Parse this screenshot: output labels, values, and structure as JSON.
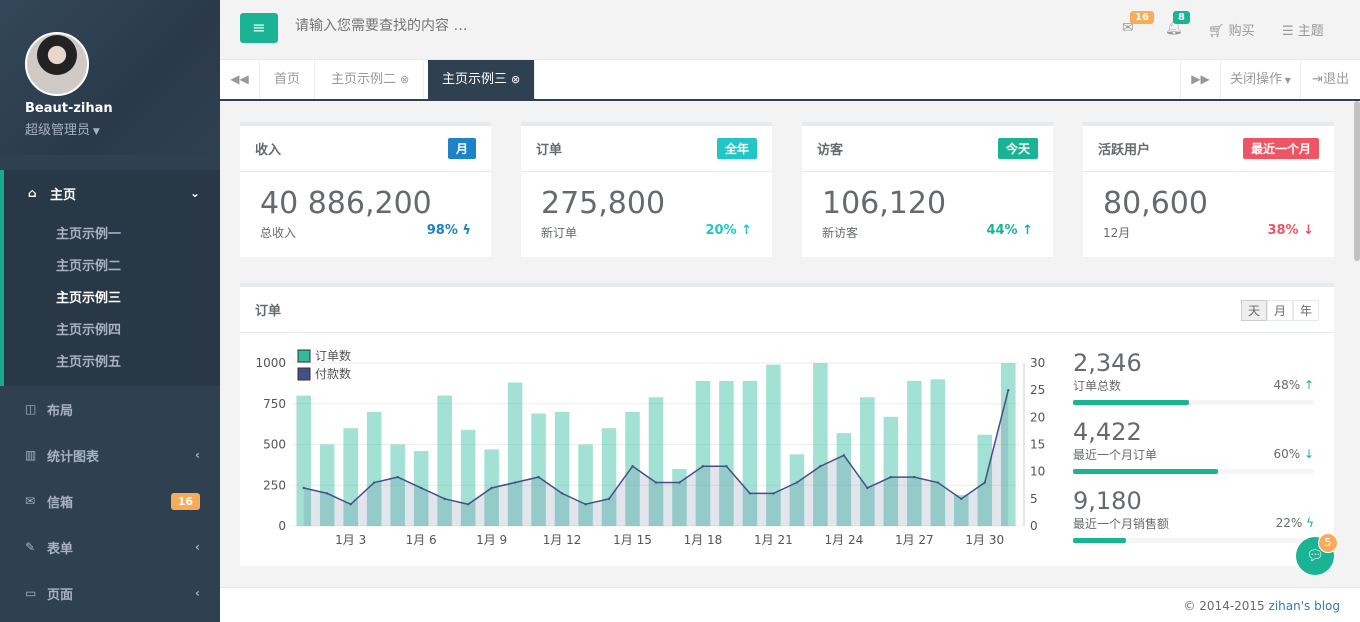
{
  "user": {
    "name": "Beaut-zihan",
    "role": "超级管理员"
  },
  "nav": {
    "home": {
      "label": "主页",
      "subs": [
        "主页示例一",
        "主页示例二",
        "主页示例三",
        "主页示例四",
        "主页示例五"
      ],
      "active_sub": 2
    },
    "items": [
      {
        "label": "布局",
        "icon": "columns-icon"
      },
      {
        "label": "统计图表",
        "icon": "bar-chart-icon"
      },
      {
        "label": "信箱",
        "icon": "envelope-icon",
        "badge": "16"
      },
      {
        "label": "表单",
        "icon": "edit-icon"
      },
      {
        "label": "页面",
        "icon": "desktop-icon"
      }
    ]
  },
  "topbar": {
    "search_placeholder": "请输入您需要查找的内容 …",
    "mail_count": "16",
    "alert_count": "8",
    "buy": "购买",
    "theme": "主题"
  },
  "tabs": {
    "items": [
      "首页",
      "主页示例二",
      "主页示例三"
    ],
    "active": 2,
    "close_ops": "关闭操作",
    "logout": "退出"
  },
  "stats": [
    {
      "title": "收入",
      "label": "月",
      "label_color": "#1c84c6",
      "value": "40 886,200",
      "sub": "总收入",
      "pct": "98%",
      "pct_icon": "bolt-icon",
      "pct_color": "#1c84c6"
    },
    {
      "title": "订单",
      "label": "全年",
      "label_color": "#23c6c8",
      "value": "275,800",
      "sub": "新订单",
      "pct": "20%",
      "pct_icon": "arrow-up-icon",
      "pct_color": "#23c6c8"
    },
    {
      "title": "访客",
      "label": "今天",
      "label_color": "#1ab394",
      "value": "106,120",
      "sub": "新访客",
      "pct": "44%",
      "pct_icon": "arrow-up-icon",
      "pct_color": "#1ab394"
    },
    {
      "title": "活跃用户",
      "label": "最近一个月",
      "label_color": "#ed5565",
      "value": "80,600",
      "sub": "12月",
      "pct": "38%",
      "pct_icon": "arrow-down-icon",
      "pct_color": "#ed5565"
    }
  ],
  "order_panel": {
    "title": "订单",
    "periods": [
      "天",
      "月",
      "年"
    ],
    "active_period": 0,
    "right_stats": [
      {
        "value": "2,346",
        "label": "订单总数",
        "pct": "48%",
        "icon": "arrow-up-icon",
        "color": "#1ab394",
        "progress": 0.48
      },
      {
        "value": "4,422",
        "label": "最近一个月订单",
        "pct": "60%",
        "icon": "arrow-down-icon",
        "color": "#1ab394",
        "progress": 0.6
      },
      {
        "value": "9,180",
        "label": "最近一个月销售额",
        "pct": "22%",
        "icon": "bolt-icon",
        "color": "#1ab394",
        "progress": 0.22
      }
    ]
  },
  "chart_data": {
    "type": "bar",
    "categories": [
      "1",
      "2",
      "3",
      "4",
      "5",
      "6",
      "7",
      "8",
      "9",
      "10",
      "11",
      "12",
      "13",
      "14",
      "15",
      "16",
      "17",
      "18",
      "19",
      "20",
      "21",
      "22",
      "23",
      "24",
      "25",
      "26",
      "27",
      "28",
      "29",
      "30",
      "31"
    ],
    "tick_labels": [
      "1月 3",
      "1月 6",
      "1月 9",
      "1月 12",
      "1月 15",
      "1月 18",
      "1月 21",
      "1月 24",
      "1月 27",
      "1月 30"
    ],
    "tick_days": [
      3,
      6,
      9,
      12,
      15,
      18,
      21,
      24,
      27,
      30
    ],
    "series": [
      {
        "name": "订单数",
        "type": "bar",
        "axis": "left",
        "color": "#1ab394",
        "values": [
          800,
          500,
          600,
          700,
          500,
          460,
          800,
          590,
          470,
          880,
          690,
          700,
          500,
          600,
          700,
          790,
          350,
          890,
          890,
          890,
          990,
          440,
          1000,
          570,
          790,
          670,
          890,
          900,
          190,
          560,
          1000
        ]
      },
      {
        "name": "付款数",
        "type": "area",
        "axis": "right",
        "color": "#464f88",
        "values": [
          7,
          6,
          4,
          8,
          9,
          7,
          5,
          4,
          7,
          8,
          9,
          6,
          4,
          5,
          11,
          8,
          8,
          11,
          11,
          6,
          6,
          8,
          11,
          13,
          7,
          9,
          9,
          8,
          5,
          8,
          25
        ]
      }
    ],
    "ylim_left": [
      0,
      1000
    ],
    "yticks_left": [
      0,
      250,
      500,
      750,
      1000
    ],
    "ylim_right": [
      0,
      30
    ],
    "yticks_right": [
      0,
      5,
      10,
      15,
      20,
      25,
      30
    ],
    "legend": "top-left",
    "grid": true
  },
  "footer": {
    "copyright": "© 2014-2015 ",
    "link": "zihan's blog"
  },
  "chat_badge": "5"
}
